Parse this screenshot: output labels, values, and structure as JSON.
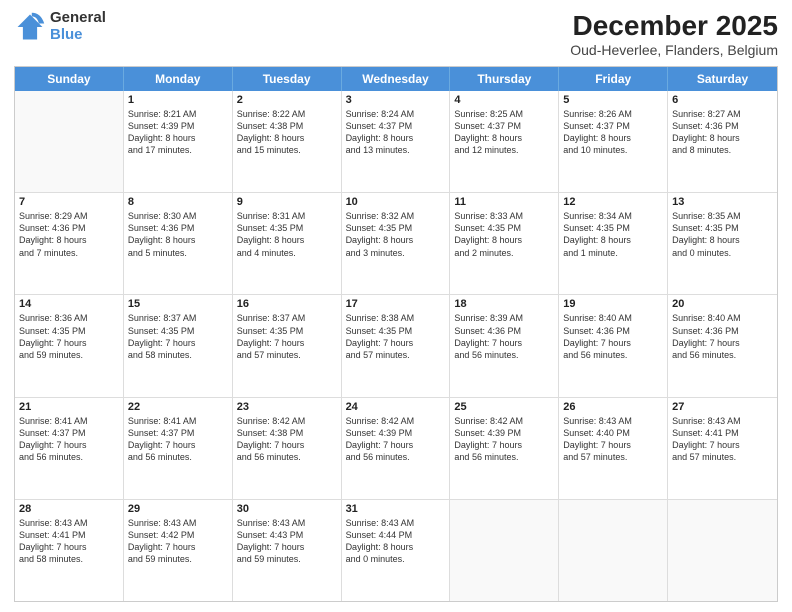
{
  "logo": {
    "general": "General",
    "blue": "Blue"
  },
  "header": {
    "month": "December 2025",
    "location": "Oud-Heverlee, Flanders, Belgium"
  },
  "days": [
    "Sunday",
    "Monday",
    "Tuesday",
    "Wednesday",
    "Thursday",
    "Friday",
    "Saturday"
  ],
  "weeks": [
    [
      {
        "day": "",
        "info": ""
      },
      {
        "day": "1",
        "info": "Sunrise: 8:21 AM\nSunset: 4:39 PM\nDaylight: 8 hours\nand 17 minutes."
      },
      {
        "day": "2",
        "info": "Sunrise: 8:22 AM\nSunset: 4:38 PM\nDaylight: 8 hours\nand 15 minutes."
      },
      {
        "day": "3",
        "info": "Sunrise: 8:24 AM\nSunset: 4:37 PM\nDaylight: 8 hours\nand 13 minutes."
      },
      {
        "day": "4",
        "info": "Sunrise: 8:25 AM\nSunset: 4:37 PM\nDaylight: 8 hours\nand 12 minutes."
      },
      {
        "day": "5",
        "info": "Sunrise: 8:26 AM\nSunset: 4:37 PM\nDaylight: 8 hours\nand 10 minutes."
      },
      {
        "day": "6",
        "info": "Sunrise: 8:27 AM\nSunset: 4:36 PM\nDaylight: 8 hours\nand 8 minutes."
      }
    ],
    [
      {
        "day": "7",
        "info": "Sunrise: 8:29 AM\nSunset: 4:36 PM\nDaylight: 8 hours\nand 7 minutes."
      },
      {
        "day": "8",
        "info": "Sunrise: 8:30 AM\nSunset: 4:36 PM\nDaylight: 8 hours\nand 5 minutes."
      },
      {
        "day": "9",
        "info": "Sunrise: 8:31 AM\nSunset: 4:35 PM\nDaylight: 8 hours\nand 4 minutes."
      },
      {
        "day": "10",
        "info": "Sunrise: 8:32 AM\nSunset: 4:35 PM\nDaylight: 8 hours\nand 3 minutes."
      },
      {
        "day": "11",
        "info": "Sunrise: 8:33 AM\nSunset: 4:35 PM\nDaylight: 8 hours\nand 2 minutes."
      },
      {
        "day": "12",
        "info": "Sunrise: 8:34 AM\nSunset: 4:35 PM\nDaylight: 8 hours\nand 1 minute."
      },
      {
        "day": "13",
        "info": "Sunrise: 8:35 AM\nSunset: 4:35 PM\nDaylight: 8 hours\nand 0 minutes."
      }
    ],
    [
      {
        "day": "14",
        "info": "Sunrise: 8:36 AM\nSunset: 4:35 PM\nDaylight: 7 hours\nand 59 minutes."
      },
      {
        "day": "15",
        "info": "Sunrise: 8:37 AM\nSunset: 4:35 PM\nDaylight: 7 hours\nand 58 minutes."
      },
      {
        "day": "16",
        "info": "Sunrise: 8:37 AM\nSunset: 4:35 PM\nDaylight: 7 hours\nand 57 minutes."
      },
      {
        "day": "17",
        "info": "Sunrise: 8:38 AM\nSunset: 4:35 PM\nDaylight: 7 hours\nand 57 minutes."
      },
      {
        "day": "18",
        "info": "Sunrise: 8:39 AM\nSunset: 4:36 PM\nDaylight: 7 hours\nand 56 minutes."
      },
      {
        "day": "19",
        "info": "Sunrise: 8:40 AM\nSunset: 4:36 PM\nDaylight: 7 hours\nand 56 minutes."
      },
      {
        "day": "20",
        "info": "Sunrise: 8:40 AM\nSunset: 4:36 PM\nDaylight: 7 hours\nand 56 minutes."
      }
    ],
    [
      {
        "day": "21",
        "info": "Sunrise: 8:41 AM\nSunset: 4:37 PM\nDaylight: 7 hours\nand 56 minutes."
      },
      {
        "day": "22",
        "info": "Sunrise: 8:41 AM\nSunset: 4:37 PM\nDaylight: 7 hours\nand 56 minutes."
      },
      {
        "day": "23",
        "info": "Sunrise: 8:42 AM\nSunset: 4:38 PM\nDaylight: 7 hours\nand 56 minutes."
      },
      {
        "day": "24",
        "info": "Sunrise: 8:42 AM\nSunset: 4:39 PM\nDaylight: 7 hours\nand 56 minutes."
      },
      {
        "day": "25",
        "info": "Sunrise: 8:42 AM\nSunset: 4:39 PM\nDaylight: 7 hours\nand 56 minutes."
      },
      {
        "day": "26",
        "info": "Sunrise: 8:43 AM\nSunset: 4:40 PM\nDaylight: 7 hours\nand 57 minutes."
      },
      {
        "day": "27",
        "info": "Sunrise: 8:43 AM\nSunset: 4:41 PM\nDaylight: 7 hours\nand 57 minutes."
      }
    ],
    [
      {
        "day": "28",
        "info": "Sunrise: 8:43 AM\nSunset: 4:41 PM\nDaylight: 7 hours\nand 58 minutes."
      },
      {
        "day": "29",
        "info": "Sunrise: 8:43 AM\nSunset: 4:42 PM\nDaylight: 7 hours\nand 59 minutes."
      },
      {
        "day": "30",
        "info": "Sunrise: 8:43 AM\nSunset: 4:43 PM\nDaylight: 7 hours\nand 59 minutes."
      },
      {
        "day": "31",
        "info": "Sunrise: 8:43 AM\nSunset: 4:44 PM\nDaylight: 8 hours\nand 0 minutes."
      },
      {
        "day": "",
        "info": ""
      },
      {
        "day": "",
        "info": ""
      },
      {
        "day": "",
        "info": ""
      }
    ]
  ]
}
